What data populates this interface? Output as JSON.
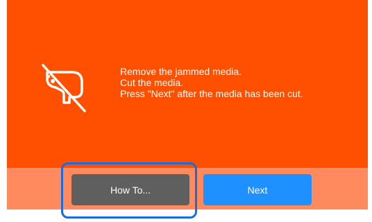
{
  "dialog": {
    "icon": "media-jam-icon",
    "message_lines": [
      "Remove the jammed media.",
      "Cut the media.",
      "Press \"Next\" after the media has been cut."
    ],
    "buttons": {
      "howto_label": "How To...",
      "next_label": "Next"
    }
  },
  "colors": {
    "screen_bg": "#ff5000",
    "button_bar_bg": "#ff8a5e",
    "howto_button": "#5f5f5f",
    "next_button": "#1e90ff",
    "highlight_frame": "#1a6bdd"
  }
}
